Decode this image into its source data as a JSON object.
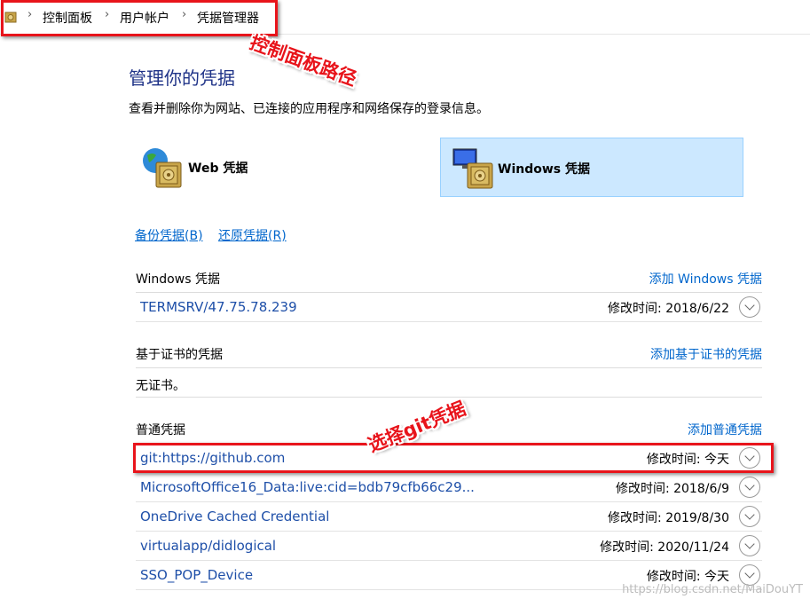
{
  "breadcrumb": {
    "items": [
      "控制面板",
      "用户帐户",
      "凭据管理器"
    ]
  },
  "annotations": {
    "path_label": "控制面板路径",
    "select_label": "选择git凭据"
  },
  "header": {
    "title": "管理你的凭据",
    "description": "查看并删除你为网站、已连接的应用程序和网络保存的登录信息。"
  },
  "credential_types": {
    "web": "Web 凭据",
    "windows": "Windows 凭据",
    "selected": "windows"
  },
  "actions": {
    "backup": "备份凭据(B)",
    "restore": "还原凭据(R)"
  },
  "sections": {
    "windows": {
      "title": "Windows 凭据",
      "add": "添加 Windows 凭据",
      "items": [
        {
          "name": "TERMSRV/47.75.78.239",
          "modified": "修改时间: 2018/6/22"
        }
      ]
    },
    "certificate": {
      "title": "基于证书的凭据",
      "add": "添加基于证书的凭据",
      "empty": "无证书。"
    },
    "generic": {
      "title": "普通凭据",
      "add": "添加普通凭据",
      "items": [
        {
          "name": "git:https://github.com",
          "modified": "修改时间: 今天"
        },
        {
          "name": "MicrosoftOffice16_Data:live:cid=bdb79cfb66c29...",
          "modified": "修改时间: 2018/6/9"
        },
        {
          "name": "OneDrive Cached Credential",
          "modified": "修改时间: 2019/8/30"
        },
        {
          "name": "virtualapp/didlogical",
          "modified": "修改时间: 2020/11/24"
        },
        {
          "name": "SSO_POP_Device",
          "modified": "修改时间: 今天"
        }
      ]
    }
  },
  "watermark": "https://blog.csdn.net/MaiDouYT",
  "colors": {
    "accent_link": "#0066cc",
    "title": "#1e3287",
    "selected_bg": "#cce8ff",
    "annotation_red": "#e8141b"
  }
}
